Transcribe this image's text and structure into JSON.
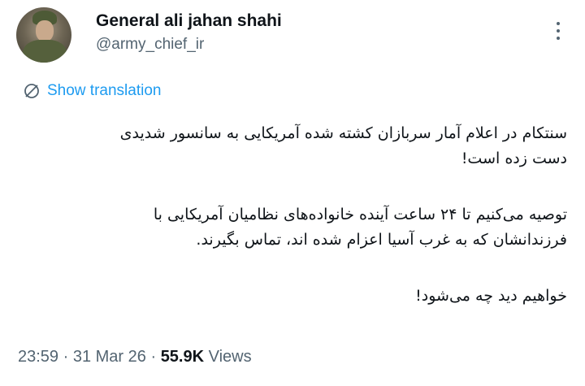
{
  "author": {
    "name": "General ali jahan shahi",
    "handle": "@army_chief_ir"
  },
  "translation": {
    "label": "Show translation",
    "icon": "globe-icon"
  },
  "tweet": {
    "paragraph1_line1": "سنتکام در اعلام آمار سربازان کشته شده آمریکایی به سانسور شدیدی",
    "paragraph1_line2": "دست زده است!",
    "paragraph2_line1": "توصیه می‌کنیم تا ۲۴ ساعت آینده خانواده‌های نظامیان آمریکایی با",
    "paragraph2_line2": "فرزندانشان که به غرب آسیا اعزام شده اند، تماس بگیرند.",
    "paragraph3_line1": "خواهیم دید چه می‌شود!"
  },
  "meta": {
    "time": "23:59",
    "separator": " · ",
    "date": "31 Mar 26",
    "views_count": "55.9K",
    "views_label": " Views"
  },
  "colors": {
    "link": "#1d9bf0",
    "secondary_text": "#536471",
    "primary_text": "#0f1419"
  }
}
